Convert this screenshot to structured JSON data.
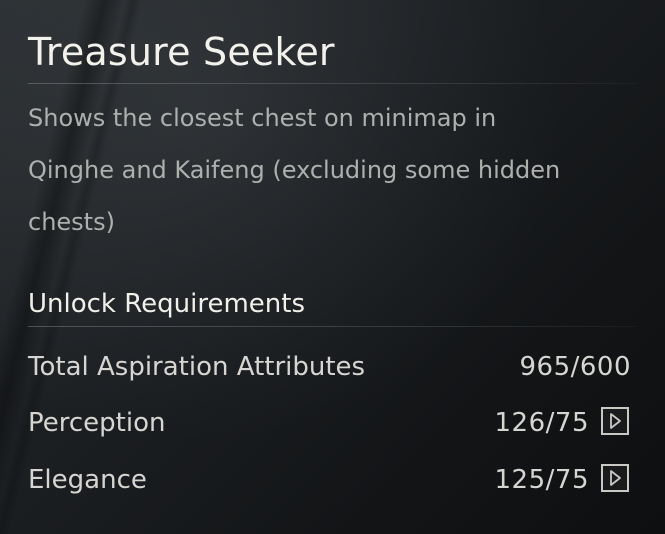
{
  "skill": {
    "title": "Treasure Seeker",
    "description_lines": [
      "Shows the closest chest on minimap in",
      "Qinghe and Kaifeng (excluding some hidden",
      "chests)"
    ]
  },
  "requirements": {
    "heading": "Unlock Requirements",
    "items": [
      {
        "label": "Total Aspiration Attributes",
        "value": "965/600"
      },
      {
        "label": "Perception",
        "value": "126/75",
        "button_icon": "arrow-right-icon"
      },
      {
        "label": "Elegance",
        "value": "125/75",
        "button_icon": "arrow-right-icon"
      }
    ]
  },
  "colors": {
    "background": "#1c1f22",
    "title_text": "#f3f1ec",
    "description_text": "#aeb0ae",
    "requirement_text": "#d6d5d1",
    "button_border": "#c9c8c3"
  }
}
